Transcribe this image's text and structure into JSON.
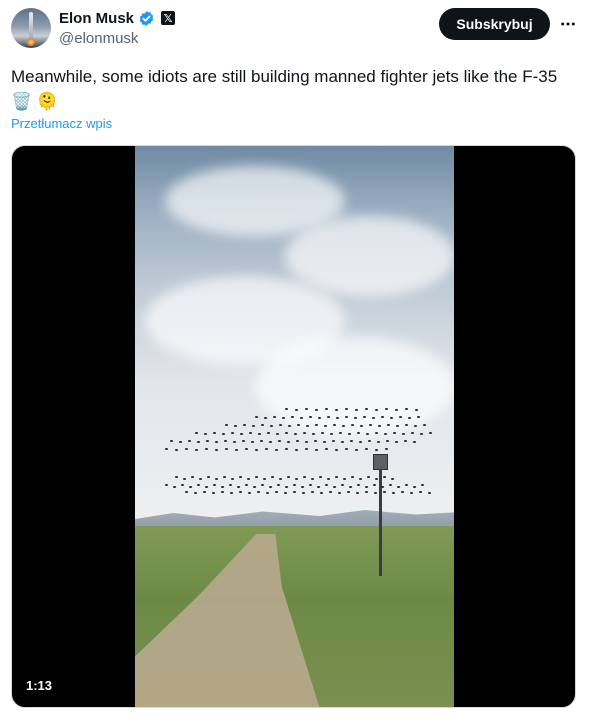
{
  "author": {
    "name": "Elon Musk",
    "handle": "@elonmusk",
    "verified_badge_icon": "verified-badge-icon",
    "affiliate_icon": "x-logo-icon",
    "affiliate_glyph": "𝕏"
  },
  "actions": {
    "subscribe_label": "Subskrybuj",
    "more_icon": "more-dots-icon"
  },
  "post": {
    "text": "Meanwhile, some idiots are still building manned fighter jets like the F-35 🗑️ 🫠",
    "translate_label": "Przetłumacz wpis"
  },
  "media": {
    "type": "video",
    "duration": "1:13"
  },
  "colors": {
    "accent": "#1d9bf0",
    "text": "#0f1419",
    "muted": "#536471",
    "button_bg": "#0f1419"
  }
}
